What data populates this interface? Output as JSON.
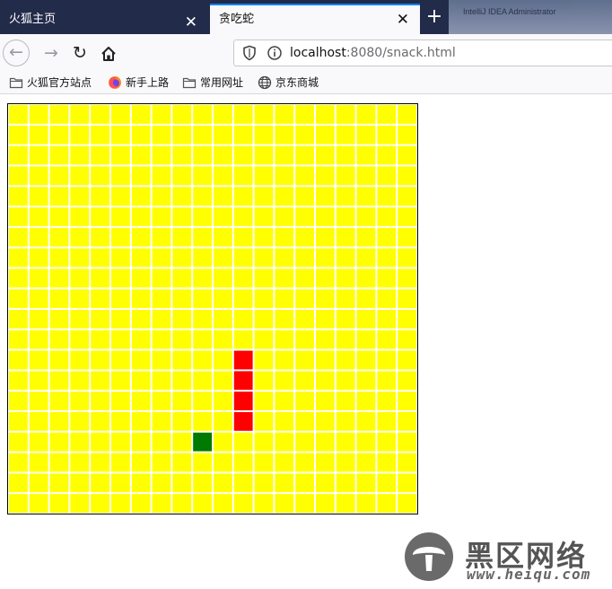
{
  "tabs": [
    {
      "title": "火狐主页",
      "active": false
    },
    {
      "title": "贪吃蛇",
      "active": true
    }
  ],
  "close_glyph": "✕",
  "new_tab_glyph": "+",
  "background_window_text": "IntelliJ IDEA Administrator",
  "address": {
    "host": "localhost",
    "rest": ":8080/snack.html"
  },
  "bookmarks": [
    {
      "label": "火狐官方站点",
      "icon": "folder-icon"
    },
    {
      "label": "新手上路",
      "icon": "firefox-icon"
    },
    {
      "label": "常用网址",
      "icon": "folder-icon"
    },
    {
      "label": "京东商城",
      "icon": "globe-icon"
    }
  ],
  "game": {
    "rows": 20,
    "cols": 20,
    "background_color": "#ffff00",
    "gridline_color": "#ffffff",
    "snake_color": "#ff0000",
    "food_color": "#007a00",
    "snake": [
      [
        11,
        12
      ],
      [
        11,
        13
      ],
      [
        11,
        14
      ],
      [
        11,
        15
      ]
    ],
    "food": [
      9,
      16
    ]
  },
  "watermark": {
    "text": "黑区网络",
    "url": "www.heiqu.com"
  }
}
